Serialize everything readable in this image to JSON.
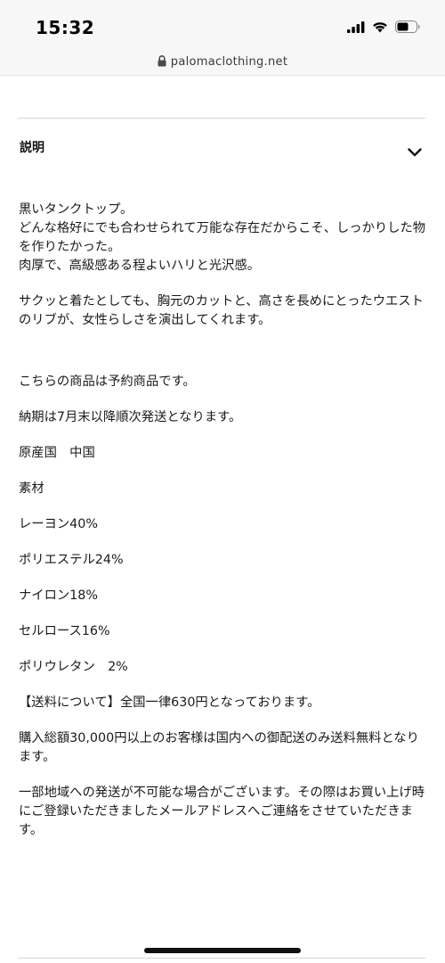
{
  "status_bar": {
    "time": "15:32",
    "icons": [
      "signal-icon",
      "wifi-icon",
      "battery-icon"
    ]
  },
  "url_bar": {
    "domain": "palomaclothing.net",
    "icon": "lock-icon"
  },
  "accordion": {
    "title": "説明",
    "icon": "chevron-down-icon",
    "expanded": true
  },
  "description": {
    "intro_lines": [
      "黒いタンクトップ。",
      "どんな格好にでも合わせられて万能な存在だからこそ、しっかりした物を作りたかった。",
      "肉厚で、高級感ある程よいハリと光沢感。"
    ],
    "paragraph2": "サクッと着たとしても、胸元のカットと、高さを長めにとったウエストのリブが、女性らしさを演出してくれます。",
    "preorder": "こちらの商品は予約商品です。",
    "delivery": "納期は7月末以降順次発送となります。",
    "origin": "原産国　中国",
    "material_label": "素材",
    "materials": [
      "レーヨン40%",
      "ポリエステル24%",
      "ナイロン18%",
      "セルロース16%",
      "ポリウレタン　2%"
    ],
    "shipping": "【送料について】全国一律630円となっております。",
    "free_shipping": "購入総額30,000円以上のお客様は国内への御配送のみ送料無料となります。",
    "notice": "一部地域への発送が不可能な場合がございます。その際はお買い上げ時にご登録いただきましたメールアドレスへご連絡をさせていただきます。"
  }
}
